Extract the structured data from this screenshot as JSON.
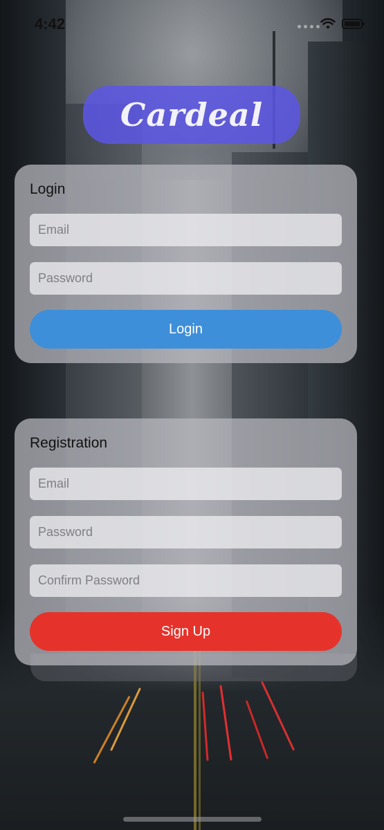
{
  "status_bar": {
    "time": "4:42"
  },
  "app": {
    "logo_text": "Cardeal"
  },
  "login": {
    "title": "Login",
    "email_placeholder": "Email",
    "password_placeholder": "Password",
    "button_label": "Login"
  },
  "registration": {
    "title": "Registration",
    "email_placeholder": "Email",
    "password_placeholder": "Password",
    "confirm_placeholder": "Confirm Password",
    "button_label": "Sign Up"
  },
  "colors": {
    "logo_bg": "#5c56e6",
    "login_button": "#3d8fd9",
    "signup_button": "#e5332b"
  }
}
